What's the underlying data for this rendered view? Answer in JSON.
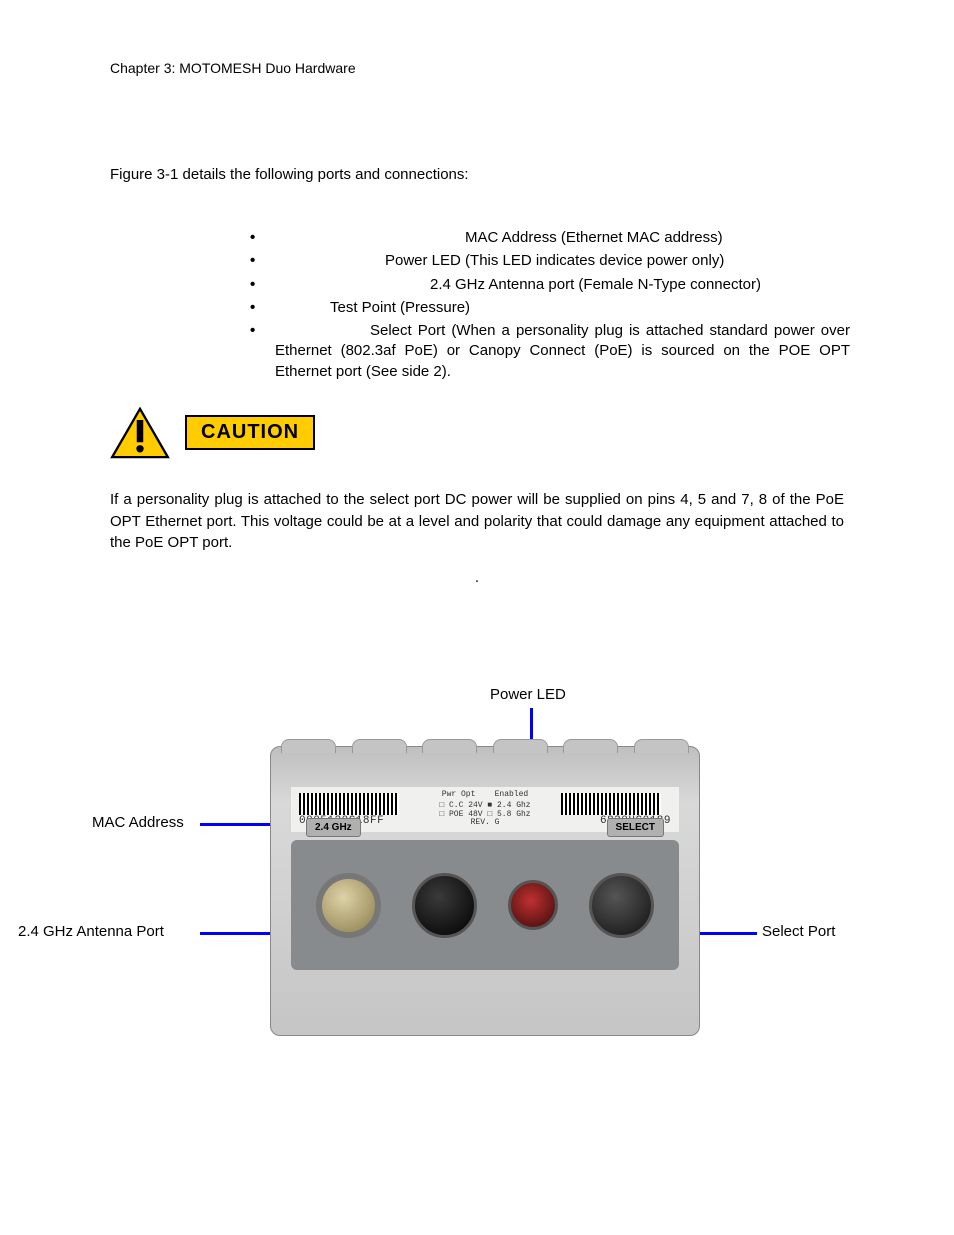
{
  "chapter_header": "Chapter 3: MOTOMESH Duo Hardware",
  "intro": "Figure 3-1 details the following ports and connections:",
  "bullets": [
    {
      "lead": "",
      "text": "MAC Address (Ethernet MAC address)"
    },
    {
      "lead": "",
      "text": "Power LED (This LED indicates device power only)"
    },
    {
      "lead": "",
      "text": "2.4 GHz Antenna port (Female N-Type connector)"
    },
    {
      "lead": "",
      "text": "Test Point (Pressure)"
    },
    {
      "lead": "",
      "text": "Select Port (When a personality plug is attached standard power over Ethernet (802.3af PoE) or Canopy Connect (PoE) is sourced on the POE OPT Ethernet port (See side 2)."
    }
  ],
  "caution_label": "CAUTION",
  "caution_body": "If a personality plug is attached to the select port DC power will be supplied on pins 4, 5 and 7, 8 of the PoE OPT Ethernet port. This voltage could be at a level and polarity that could damage any equipment attached to the PoE OPT port.",
  "sentence_dot": ".",
  "callouts": {
    "power_led": "Power LED",
    "mac_address": "MAC Address",
    "antenna_port": "2.4 GHz Antenna Port",
    "select_port": "Select Port"
  },
  "device_label": {
    "mac": "0005120C18FF",
    "serial": "6830HC0189",
    "badge_left": "2.4 GHz",
    "badge_right": "SELECT",
    "pwr_opt_hdr": "Pwr Opt",
    "enabled_hdr": "Enabled",
    "row1": "□ C.C 24V   ■ 2.4 Ghz",
    "row2": "□ POE 48V  □ 5.8 Ghz",
    "rev": "REV. G"
  }
}
